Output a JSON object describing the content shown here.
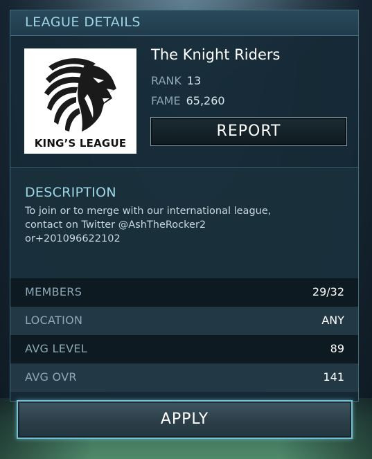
{
  "header": {
    "title": "LEAGUE DETAILS"
  },
  "league": {
    "logo_text": "KING’S LEAGUE",
    "name": "The Knight Riders",
    "rank_label": "RANK",
    "rank_value": "13",
    "fame_label": "FAME",
    "fame_value": "65,260",
    "report_label": "REPORT"
  },
  "description": {
    "title": "DESCRIPTION",
    "lines": [
      "To join or to merge with our international league,",
      "contact on Twitter @AshTheRocker2",
      "or+201096622102"
    ]
  },
  "info": [
    {
      "label": "MEMBERS",
      "value": "29/32"
    },
    {
      "label": "LOCATION",
      "value": "ANY"
    },
    {
      "label": "AVG LEVEL",
      "value": "89"
    },
    {
      "label": "AVG OVR",
      "value": "141"
    }
  ],
  "apply_label": "APPLY",
  "colors": {
    "accent": "#9fd6e6",
    "panel": "#162a36",
    "button_border": "#74bfd4"
  }
}
